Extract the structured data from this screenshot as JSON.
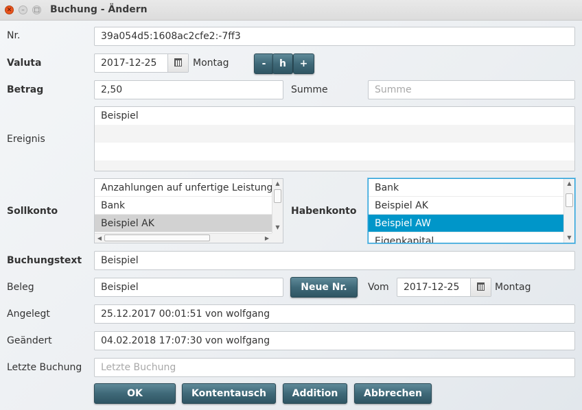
{
  "window": {
    "title": "Buchung - Ändern"
  },
  "labels": {
    "nr": "Nr.",
    "valuta": "Valuta",
    "betrag": "Betrag",
    "summe": "Summe",
    "ereignis": "Ereignis",
    "sollkonto": "Sollkonto",
    "habenkonto": "Habenkonto",
    "buchungstext": "Buchungstext",
    "beleg": "Beleg",
    "vom": "Vom",
    "angelegt": "Angelegt",
    "geaendert": "Geändert",
    "letzte_buchung": "Letzte Buchung"
  },
  "fields": {
    "nr": "39a054d5:1608ac2cfe2:-7ff3",
    "valuta_date": "2017-12-25",
    "valuta_weekday": "Montag",
    "betrag": "2,50",
    "summe_placeholder": "Summe",
    "ereignis_lines": [
      "Beispiel"
    ],
    "buchungstext": "Beispiel",
    "beleg": "Beispiel",
    "vom_date": "2017-12-25",
    "vom_weekday": "Montag",
    "angelegt": "25.12.2017 00:01:51 von wolfgang",
    "geaendert": "04.02.2018 17:07:30 von wolfgang",
    "letzte_buchung_placeholder": "Letzte Buchung"
  },
  "valuta_buttons": {
    "minus": "-",
    "h": "h",
    "plus": "+"
  },
  "sollkonto": {
    "items": [
      "Anzahlungen auf unfertige Leistungen",
      "Bank",
      "Beispiel AK"
    ],
    "highlighted": "Beispiel AK"
  },
  "habenkonto": {
    "items": [
      "Bank",
      "Beispiel AK",
      "Beispiel AW",
      "Eigenkapital"
    ],
    "selected": "Beispiel AW"
  },
  "buttons": {
    "neue_nr": "Neue Nr.",
    "ok": "OK",
    "kontentausch": "Kontentausch",
    "addition": "Addition",
    "abbrechen": "Abbrechen"
  },
  "colors": {
    "accent_button": "#3f6978",
    "selection": "#0096c9",
    "focus_border": "#2a9fd6"
  },
  "icons": [
    "close-icon",
    "minimize-icon",
    "maximize-icon",
    "calendar-icon"
  ]
}
